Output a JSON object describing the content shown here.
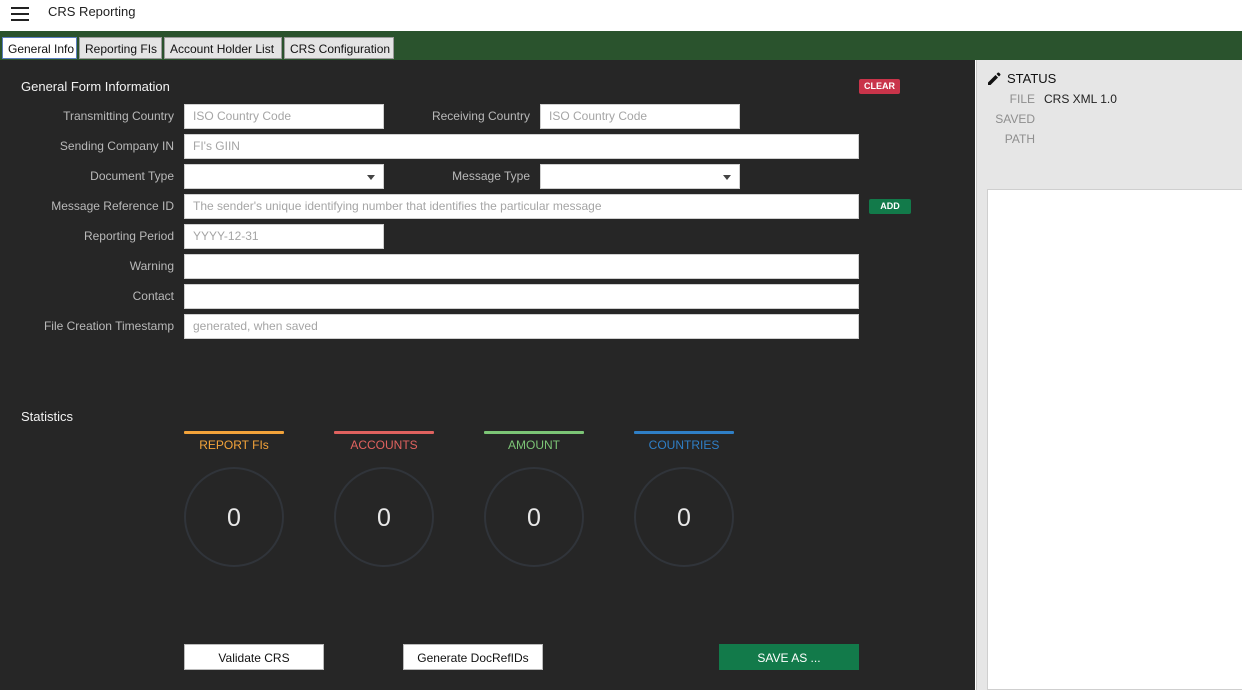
{
  "app": {
    "title": "CRS Reporting"
  },
  "tabs": [
    {
      "label": "General Info",
      "active": true
    },
    {
      "label": "Reporting FIs",
      "active": false
    },
    {
      "label": "Account Holder List",
      "active": false
    },
    {
      "label": "CRS Configuration",
      "active": false
    }
  ],
  "form": {
    "title": "General Form Information",
    "clear_label": "CLEAR",
    "add_label": "ADD",
    "fields": {
      "transmitting_country": {
        "label": "Transmitting Country",
        "placeholder": "ISO Country Code",
        "value": ""
      },
      "receiving_country": {
        "label": "Receiving Country",
        "placeholder": "ISO Country Code",
        "value": ""
      },
      "sending_company_in": {
        "label": "Sending Company IN",
        "placeholder": "FI's GIIN",
        "value": ""
      },
      "document_type": {
        "label": "Document Type",
        "value": ""
      },
      "message_type": {
        "label": "Message Type",
        "value": ""
      },
      "message_reference_id": {
        "label": "Message Reference ID",
        "placeholder": "The sender's unique identifying number that identifies the particular message",
        "value": ""
      },
      "reporting_period": {
        "label": "Reporting Period",
        "placeholder": "YYYY-12-31",
        "value": ""
      },
      "warning": {
        "label": "Warning",
        "value": ""
      },
      "contact": {
        "label": "Contact",
        "value": ""
      },
      "file_creation_timestamp": {
        "label": "File Creation Timestamp",
        "placeholder": "generated, when saved",
        "value": ""
      }
    }
  },
  "statistics": {
    "title": "Statistics",
    "items": [
      {
        "label": "REPORT FIs",
        "value": "0",
        "color": "#f3a33a"
      },
      {
        "label": "ACCOUNTS",
        "value": "0",
        "color": "#e0625f"
      },
      {
        "label": "AMOUNT",
        "value": "0",
        "color": "#7cc576"
      },
      {
        "label": "COUNTRIES",
        "value": "0",
        "color": "#2f7fc6"
      }
    ]
  },
  "actions": {
    "validate_label": "Validate CRS",
    "generate_label": "Generate DocRefIDs",
    "save_as_label": "SAVE AS ..."
  },
  "status": {
    "title": "STATUS",
    "icon": "pencil-icon",
    "file_key": "FILE",
    "file_value": "CRS XML 1.0",
    "saved_key": "SAVED",
    "saved_value": "",
    "path_key": "PATH",
    "path_value": ""
  },
  "colors": {
    "tabbar": "#2a532d",
    "panel": "#262626",
    "clear": "#c9344a",
    "add": "#127a4a",
    "save": "#127a4a"
  }
}
